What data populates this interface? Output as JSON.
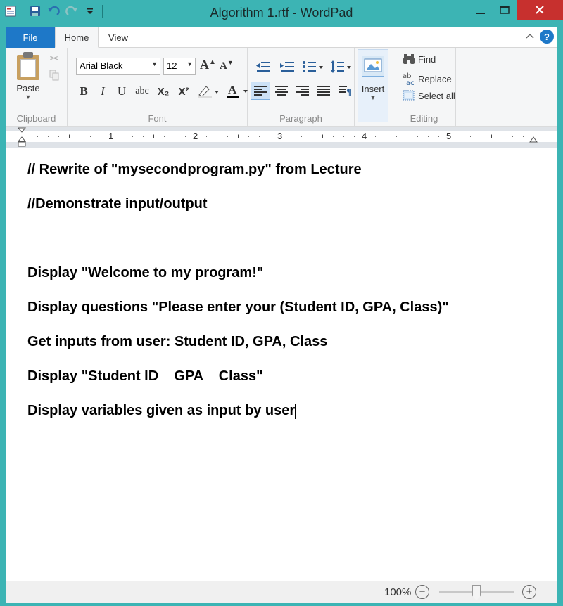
{
  "window": {
    "title": "Algorithm 1.rtf - WordPad",
    "qat_icons": [
      "wordpad-icon",
      "save-icon",
      "undo-icon",
      "redo-icon",
      "customize-icon"
    ]
  },
  "ribbon": {
    "tabs": {
      "file": "File",
      "home": "Home",
      "view": "View"
    },
    "help": "?",
    "clipboard": {
      "paste": "Paste",
      "label": "Clipboard"
    },
    "font": {
      "family": "Arial Black",
      "size": "12",
      "label": "Font",
      "bold": "B",
      "italic": "I",
      "underline": "U",
      "strike": "abc",
      "subscript": "X₂",
      "superscript": "X²"
    },
    "paragraph": {
      "label": "Paragraph"
    },
    "insert": {
      "label": "Insert"
    },
    "editing": {
      "find": "Find",
      "replace": "Replace",
      "select_all": "Select all",
      "label": "Editing"
    }
  },
  "ruler": {
    "numbers": [
      "1",
      "2",
      "3",
      "4",
      "5"
    ]
  },
  "document": {
    "lines": [
      "// Rewrite of \"mysecondprogram.py\" from Lecture",
      "//Demonstrate input/output",
      "Display \"Welcome to my program!\"",
      "Display questions \"Please enter your (Student ID, GPA, Class)\"",
      "Get inputs from user: Student ID, GPA, Class",
      "Display \"Student ID    GPA    Class\"",
      "Display variables given as input by user"
    ]
  },
  "status": {
    "zoom": "100%",
    "zoom_out": "−",
    "zoom_in": "+",
    "zoom_fraction": 0.5
  },
  "colors": {
    "titlebar": "#3cb4b4",
    "accent": "#1e78c8",
    "close": "#c7302e",
    "text_color_swatch": "#000000"
  }
}
